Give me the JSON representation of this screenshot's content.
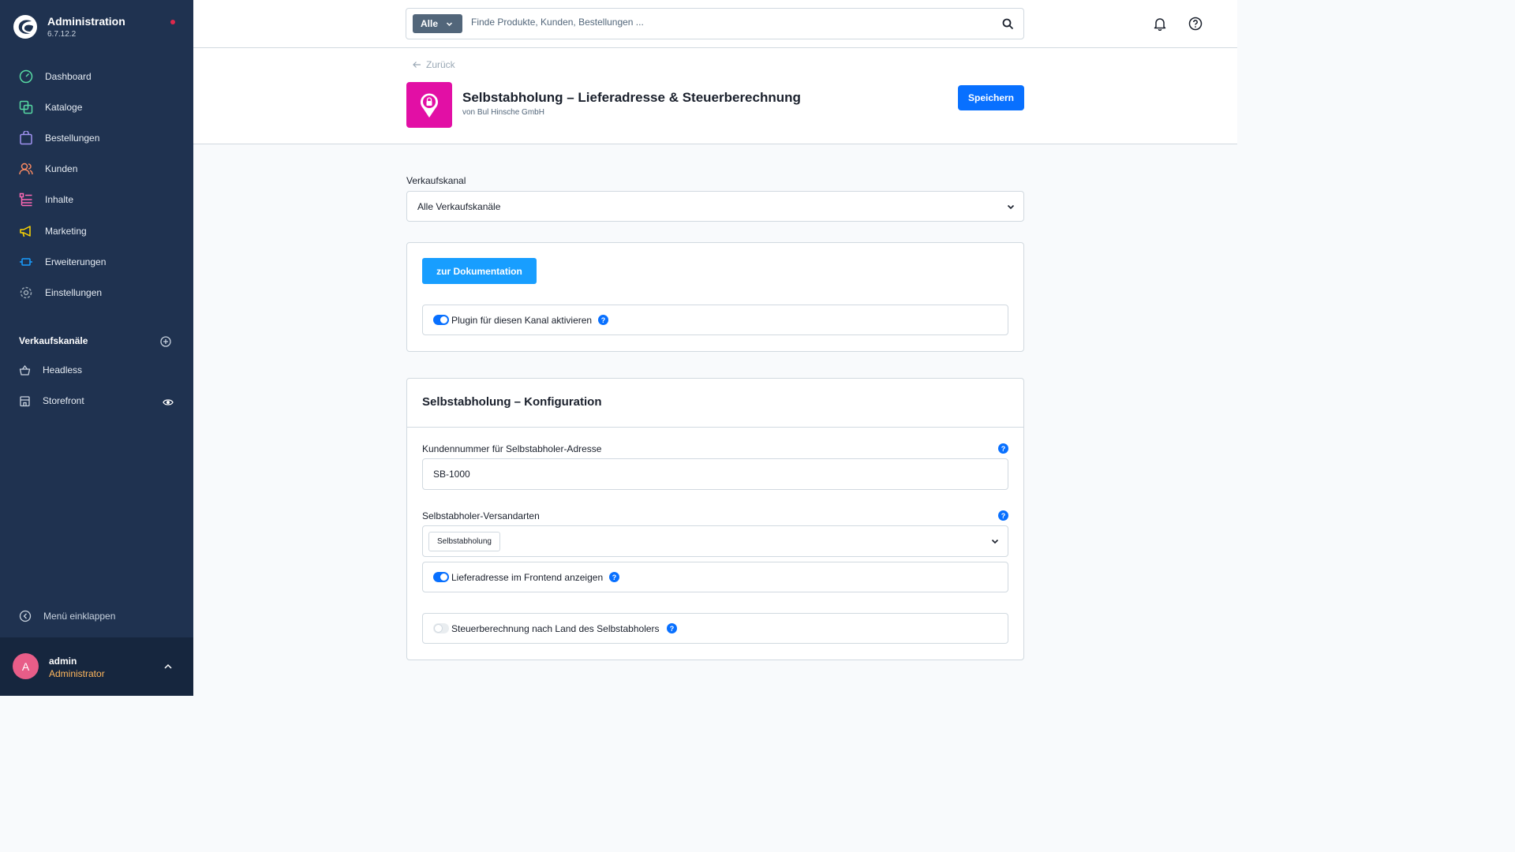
{
  "app": {
    "title": "Administration",
    "version": "6.7.12.2"
  },
  "sidebar": {
    "items": [
      {
        "label": "Dashboard",
        "icon": "dashboard-icon",
        "color": "#57d9a3"
      },
      {
        "label": "Kataloge",
        "icon": "catalog-icon",
        "color": "#57d9a3"
      },
      {
        "label": "Bestellungen",
        "icon": "orders-icon",
        "color": "#a092f0"
      },
      {
        "label": "Kunden",
        "icon": "customers-icon",
        "color": "#f88962"
      },
      {
        "label": "Inhalte",
        "icon": "content-icon",
        "color": "#ff68b4"
      },
      {
        "label": "Marketing",
        "icon": "marketing-icon",
        "color": "#ffd700"
      },
      {
        "label": "Erweiterungen",
        "icon": "extensions-icon",
        "color": "#189eff"
      },
      {
        "label": "Einstellungen",
        "icon": "settings-icon",
        "color": "#9aa8b5"
      }
    ],
    "sales_channels_title": "Verkaufskanäle",
    "sales_channels": [
      {
        "label": "Headless",
        "icon": "basket-icon"
      },
      {
        "label": "Storefront",
        "icon": "storefront-icon"
      }
    ],
    "collapse_label": "Menü einklappen",
    "user": {
      "initial": "A",
      "name": "admin",
      "role": "Administrator"
    }
  },
  "search": {
    "type_label": "Alle",
    "placeholder": "Finde Produkte, Kunden, Bestellungen ..."
  },
  "page": {
    "back_label": "Zurück",
    "title": "Selbstabholung – Lieferadresse & Steuerberechnung",
    "vendor": "von Bul Hinsche GmbH",
    "save_label": "Speichern",
    "plugin_icon_color": "#e20fa5"
  },
  "sales_channel": {
    "label": "Verkaufskanal",
    "value": "Alle Verkaufskanäle"
  },
  "general": {
    "doc_button": "zur Dokumentation",
    "activate_label": "Plugin für diesen Kanal aktivieren",
    "activate_on": true
  },
  "config": {
    "title": "Selbstabholung – Konfiguration",
    "customer_number_label": "Kundennummer für Selbstabholer-Adresse",
    "customer_number_value": "SB-1000",
    "shipping_methods_label": "Selbstabholer-Versandarten",
    "shipping_methods_selected": "Selbstabholung",
    "show_address_label": "Lieferadresse im Frontend anzeigen",
    "show_address_on": true,
    "tax_label": "Steuerberechnung nach Land des Selbstabholers",
    "tax_on": false
  },
  "help_glyph": "?"
}
